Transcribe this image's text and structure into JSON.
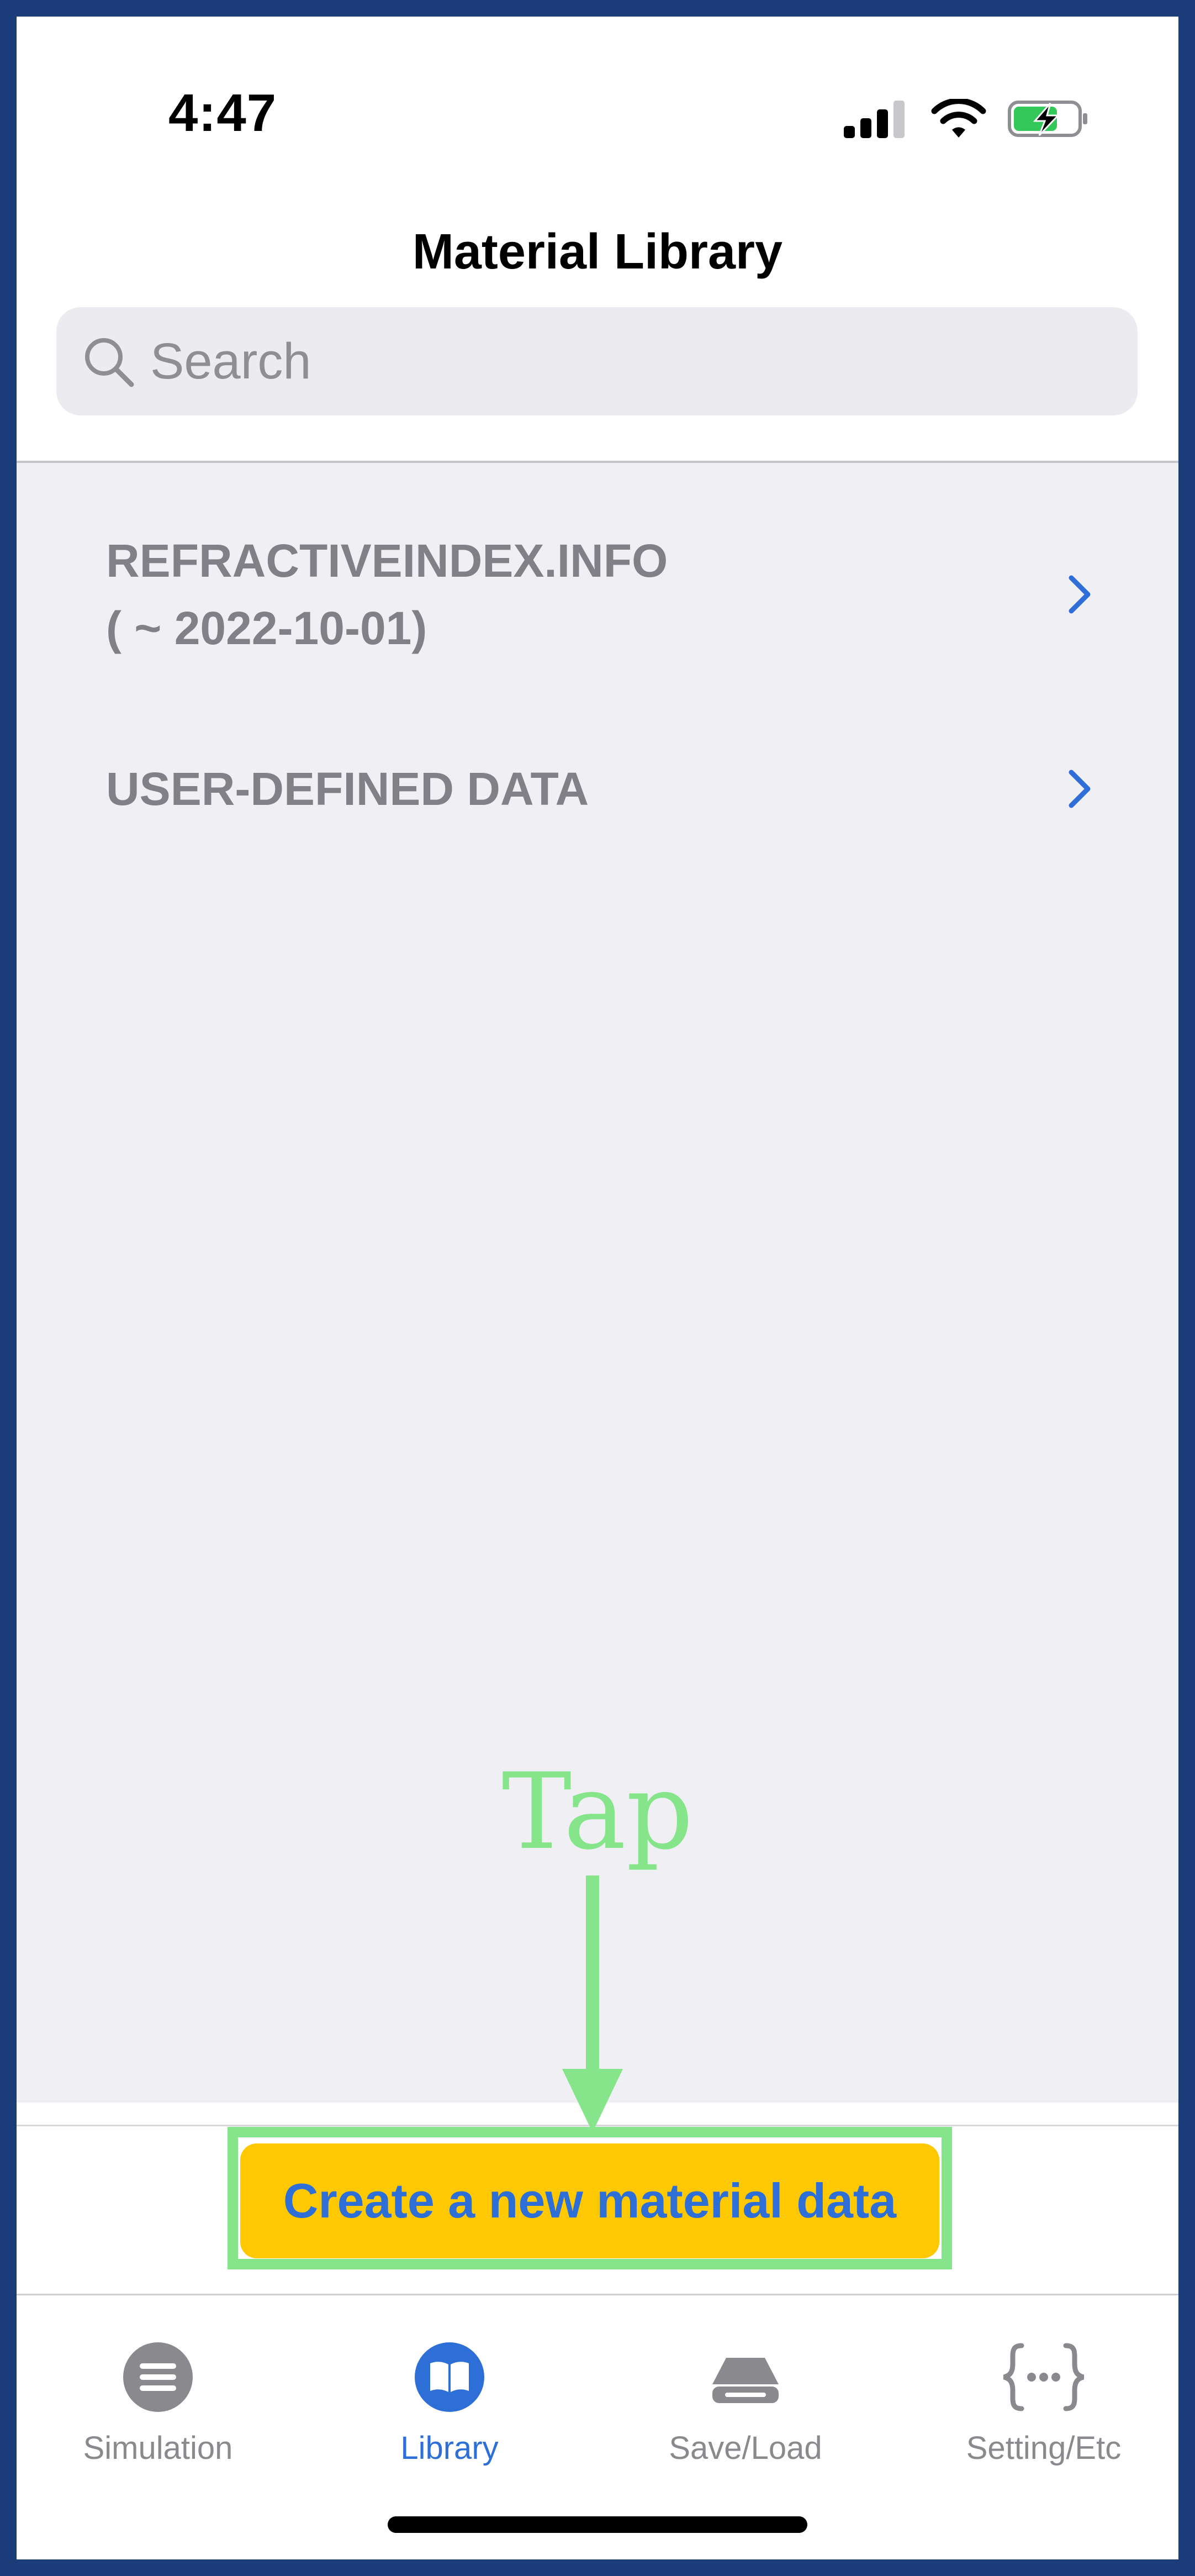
{
  "status_bar": {
    "time": "4:47"
  },
  "header": {
    "title": "Material Library"
  },
  "search": {
    "placeholder": "Search"
  },
  "list": {
    "items": [
      {
        "line1": "REFRACTIVEINDEX.INFO",
        "line2": "( ~ 2022-10-01)"
      },
      {
        "line1": "USER-DEFINED DATA"
      }
    ]
  },
  "annotation": {
    "tap_label": "Tap",
    "color": "#86e58a"
  },
  "create_button": {
    "label": "Create a new material data",
    "background": "#ffc800",
    "text_color": "#2d6fd6"
  },
  "tab_bar": {
    "active_color": "#2d6fd6",
    "inactive_color": "#8a8a8e",
    "tabs": [
      {
        "label": "Simulation",
        "icon": "list-lines-icon"
      },
      {
        "label": "Library",
        "icon": "book-icon"
      },
      {
        "label": "Save/Load",
        "icon": "drive-icon"
      },
      {
        "label": "Setting/Etc",
        "icon": "curly-braces-icon"
      }
    ]
  }
}
